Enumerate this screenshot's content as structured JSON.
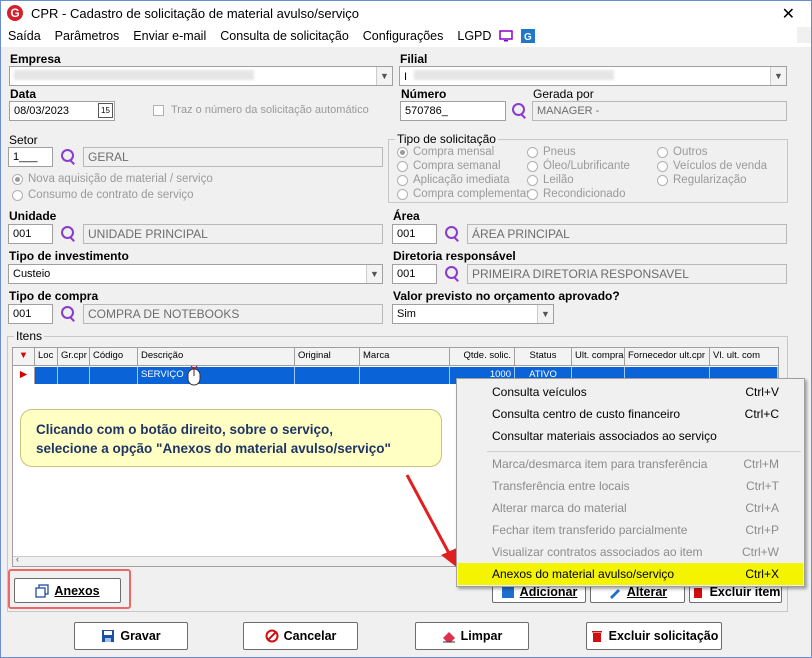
{
  "window": {
    "title": "CPR - Cadastro de solicitação de material avulso/serviço",
    "close": "✕"
  },
  "menu": {
    "items": [
      "Saída",
      "Parâmetros",
      "Enviar e-mail",
      "Consulta de solicitação",
      "Configurações",
      "LGPD"
    ]
  },
  "form": {
    "empresa_label": "Empresa",
    "filial_label": "Filial",
    "filial_value": "I",
    "data_label": "Data",
    "data_value": "08/03/2023",
    "calendar_day": "15",
    "auto_number_label": "Traz o número da solicitação automático",
    "numero_label": "Número",
    "numero_value": "570786_",
    "gerada_por_label": "Gerada por",
    "gerada_por_value": "MANAGER -",
    "setor_label": "Setor",
    "setor_code": "1___",
    "setor_name": "GERAL",
    "aquisicao_options": [
      "Nova aquisição de material / serviço",
      "Consumo de contrato de serviço"
    ],
    "tipo_solicitacao_label": "Tipo de solicitação",
    "tipo_col1": [
      "Compra mensal",
      "Compra semanal",
      "Aplicação imediata",
      "Compra complementar"
    ],
    "tipo_col2": [
      "Pneus",
      "Óleo/Lubrificante",
      "Leilão",
      "Recondicionado"
    ],
    "tipo_col3": [
      "Outros",
      "Veículos de venda",
      "Regularização"
    ],
    "unidade_label": "Unidade",
    "unidade_code": "001",
    "unidade_name": "UNIDADE PRINCIPAL",
    "area_label": "Área",
    "area_code": "001",
    "area_name": "ÁREA PRINCIPAL",
    "tipo_investimento_label": "Tipo de investimento",
    "tipo_investimento_value": "Custeio",
    "diretoria_label": "Diretoria responsável",
    "diretoria_code": "001",
    "diretoria_name": "PRIMEIRA DIRETORIA RESPONSAVEL",
    "tipo_compra_label": "Tipo de compra",
    "tipo_compra_code": "001",
    "tipo_compra_name": "COMPRA DE NOTEBOOKS",
    "valor_previsto_label": "Valor previsto no orçamento aprovado?",
    "valor_previsto_value": "Sim"
  },
  "itens": {
    "label": "Itens",
    "columns": [
      "Loc",
      "Gr.cpr",
      "Código",
      "Descrição",
      "Original",
      "Marca",
      "Qtde. solic.",
      "Status",
      "Ult. compra",
      "Fornecedor ult.cpr",
      "Vl. ult. com"
    ],
    "row": {
      "descricao": "SERVIÇO",
      "qtde": "1000",
      "status": "ATIVO"
    }
  },
  "item_buttons": {
    "anexos": "Anexos",
    "adicionar": "Adicionar",
    "alterar": "Alterar",
    "excluir_item": "Excluir item"
  },
  "context_menu": {
    "items": [
      {
        "label": "Consulta veículos",
        "shortcut": "Ctrl+V"
      },
      {
        "label": "Consulta centro de custo financeiro",
        "shortcut": "Ctrl+C"
      },
      {
        "label": "Consultar materiais associados ao serviço",
        "shortcut": ""
      },
      {
        "label": "Marca/desmarca item para transferência",
        "shortcut": "Ctrl+M"
      },
      {
        "label": "Transferência entre locais",
        "shortcut": "Ctrl+T"
      },
      {
        "label": "Alterar marca do material",
        "shortcut": "Ctrl+A"
      },
      {
        "label": "Fechar item transferido parcialmente",
        "shortcut": "Ctrl+P"
      },
      {
        "label": "Visualizar contratos associados ao item",
        "shortcut": "Ctrl+W"
      },
      {
        "label": "Anexos do material avulso/serviço",
        "shortcut": "Ctrl+X"
      }
    ]
  },
  "callout": {
    "line1": "Clicando com o botão direito, sobre o serviço,",
    "line2": "selecione a opção \"Anexos do material avulso/serviço\""
  },
  "bottom_buttons": {
    "gravar": "Gravar",
    "cancelar": "Cancelar",
    "limpar": "Limpar",
    "excluir_solicitacao": "Excluir solicitação"
  },
  "colors": {
    "selection_row": "#0a64d8",
    "menu_highlight": "#f4f400",
    "accent_purple": "#8a3bd1",
    "app_red": "#d4202a"
  }
}
